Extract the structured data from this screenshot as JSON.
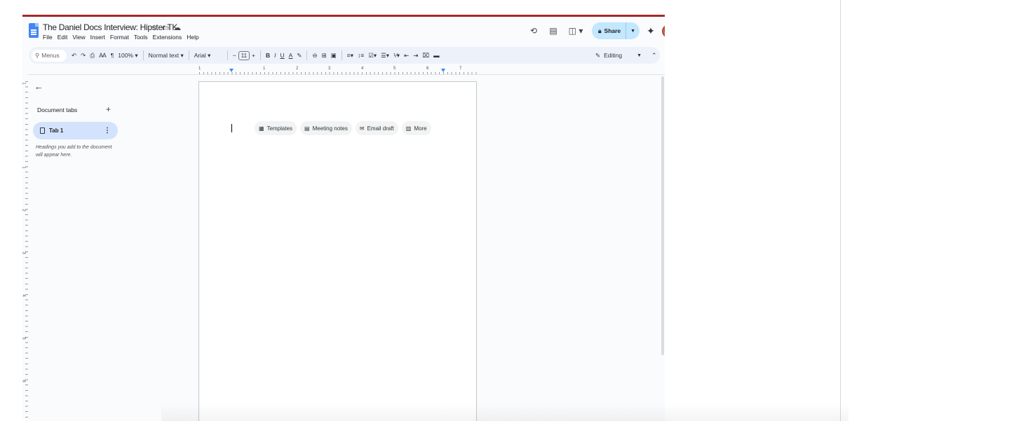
{
  "document": {
    "title": "The Daniel Docs Interview: Hipster TK"
  },
  "title_icons": [
    "star-icon",
    "move-folder-icon",
    "cloud-status-icon"
  ],
  "menu": [
    "File",
    "Edit",
    "View",
    "Insert",
    "Format",
    "Tools",
    "Extensions",
    "Help"
  ],
  "header": {
    "share_label": "Share"
  },
  "toolbar": {
    "search_placeholder": "Menus",
    "zoom": "100%",
    "style": "Normal text",
    "font": "Arial",
    "font_size": "11",
    "mode": "Editing"
  },
  "ruler": {
    "h_marks": [
      "1",
      "1",
      "2",
      "3",
      "4",
      "5",
      "6",
      "7"
    ],
    "v_marks": [
      "1",
      "1",
      "2",
      "3",
      "4",
      "5",
      "6"
    ]
  },
  "tabs_panel": {
    "title": "Document tabs",
    "tab_label": "Tab 1",
    "hint": "Headings you add to the document will appear here."
  },
  "chips": [
    "Templates",
    "Meeting notes",
    "Email draft",
    "More"
  ],
  "colors": {
    "accent": "#a52a2a",
    "share_bg": "#c2e7ff",
    "tab_active": "#d3e3fd",
    "docs_blue": "#4285f4"
  }
}
